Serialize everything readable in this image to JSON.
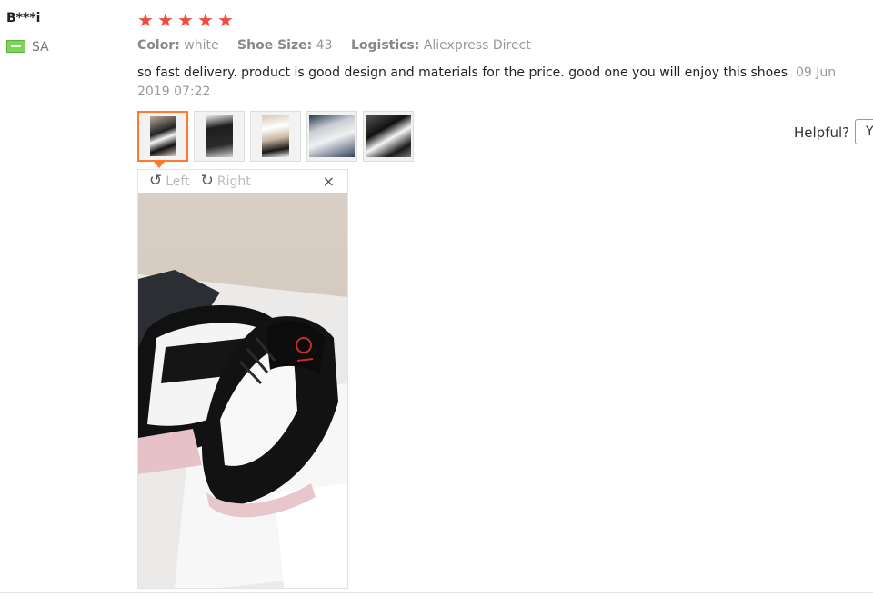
{
  "reviewer": {
    "name": "B***i",
    "country_code": "SA"
  },
  "rating": {
    "stars": 5,
    "max": 5,
    "color": "#f04b3f"
  },
  "attributes": [
    {
      "key": "Color:",
      "value": "white"
    },
    {
      "key": "Shoe Size:",
      "value": "43"
    },
    {
      "key": "Logistics:",
      "value": "Aliexpress Direct"
    }
  ],
  "review": {
    "text": "so fast delivery. product is good design and materials for the price. good one you will enjoy this shoes",
    "date": "09 Jun 2019 07:22"
  },
  "thumbnails": [
    {
      "icon": "photo-thumbnail-1"
    },
    {
      "icon": "photo-thumbnail-2"
    },
    {
      "icon": "photo-thumbnail-3"
    },
    {
      "icon": "photo-thumbnail-4"
    },
    {
      "icon": "photo-thumbnail-5"
    }
  ],
  "viewer": {
    "rotate_left_label": "Left",
    "rotate_right_label": "Right",
    "close_symbol": "×"
  },
  "helpful": {
    "label": "Helpful?",
    "button_label": "Y"
  },
  "colors": {
    "accent": "#ff7a2c",
    "flag": "#7ed35a"
  }
}
